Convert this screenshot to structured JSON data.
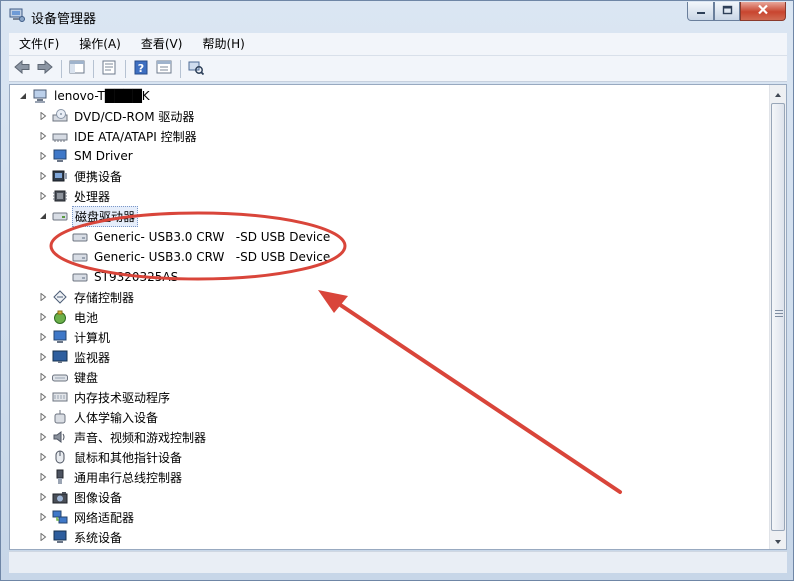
{
  "window": {
    "title": "设备管理器",
    "buttons": {
      "minimize": "minimize",
      "maximize": "maximize",
      "close": "close"
    }
  },
  "menu": [
    "文件(F)",
    "操作(A)",
    "查看(V)",
    "帮助(H)"
  ],
  "toolbar": [
    "back-icon",
    "forward-icon",
    "show-hide-tree-icon",
    "properties-icon",
    "help-icon",
    "view-icon",
    "scan-hardware-icon"
  ],
  "tree": {
    "root": "lenovo-T████K",
    "items": [
      {
        "label": "DVD/CD-ROM 驱动器",
        "icon": "dvd-drive-icon"
      },
      {
        "label": "IDE ATA/ATAPI 控制器",
        "icon": "ide-controller-icon"
      },
      {
        "label": "SM Driver",
        "icon": "sm-driver-icon"
      },
      {
        "label": "便携设备",
        "icon": "portable-device-icon"
      },
      {
        "label": "处理器",
        "icon": "processor-icon"
      },
      {
        "label": "磁盘驱动器",
        "icon": "disk-drive-icon",
        "expanded": true,
        "selected": true,
        "children": [
          {
            "label": "Generic- USB3.0 CRW   -SD USB Device"
          },
          {
            "label": "Generic- USB3.0 CRW   -SD USB Device"
          },
          {
            "label": "ST9320325AS"
          }
        ]
      },
      {
        "label": "存储控制器",
        "icon": "storage-controller-icon"
      },
      {
        "label": "电池",
        "icon": "battery-icon"
      },
      {
        "label": "计算机",
        "icon": "computer-icon"
      },
      {
        "label": "监视器",
        "icon": "monitor-icon"
      },
      {
        "label": "键盘",
        "icon": "keyboard-icon"
      },
      {
        "label": "内存技术驱动程序",
        "icon": "memory-driver-icon"
      },
      {
        "label": "人体学输入设备",
        "icon": "hid-icon"
      },
      {
        "label": "声音、视频和游戏控制器",
        "icon": "sound-icon"
      },
      {
        "label": "鼠标和其他指针设备",
        "icon": "mouse-icon"
      },
      {
        "label": "通用串行总线控制器",
        "icon": "usb-controller-icon"
      },
      {
        "label": "图像设备",
        "icon": "imaging-device-icon"
      },
      {
        "label": "网络适配器",
        "icon": "network-adapter-icon"
      },
      {
        "label": "系统设备",
        "icon": "system-device-icon"
      }
    ]
  },
  "colors": {
    "annotation_red": "#d9453a",
    "selection_border": "#7a96c6"
  }
}
